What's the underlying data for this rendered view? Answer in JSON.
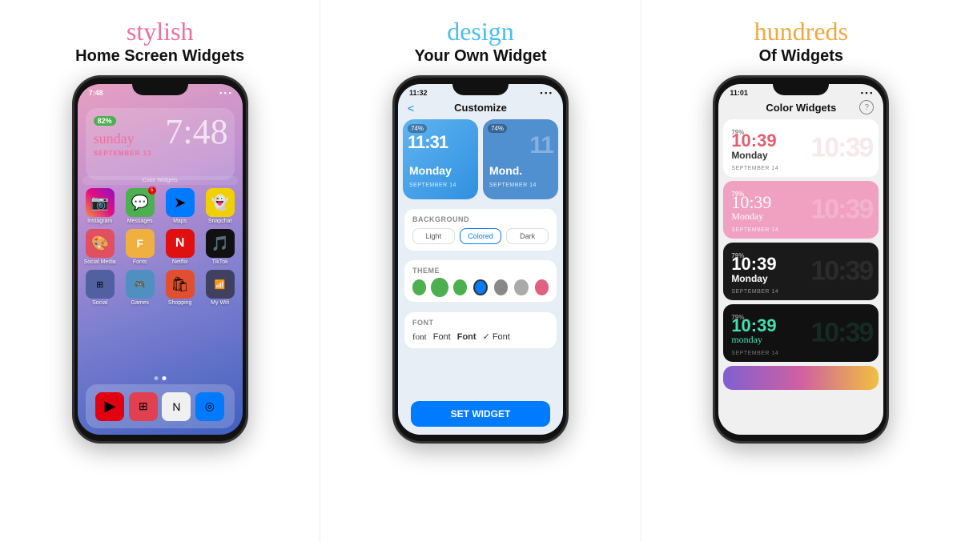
{
  "panel1": {
    "heading_cursive": "stylish",
    "heading_bold": "Home Screen Widgets",
    "status_time": "7:48",
    "battery": "82%",
    "time_display": "7:48",
    "day": "sunday",
    "date": "SEPTEMBER 13",
    "apps_row1": [
      {
        "icon": "📷",
        "label": "Instagram",
        "bg": "#c060a0"
      },
      {
        "icon": "💬",
        "label": "Messages",
        "bg": "#4caf50"
      },
      {
        "icon": "➤",
        "label": "Maps",
        "bg": "#007aff"
      },
      {
        "icon": "👻",
        "label": "Snapchat",
        "bg": "#f0d000"
      }
    ],
    "apps_row2": [
      {
        "icon": "🎨",
        "label": "Social Media",
        "bg": "#e05060"
      },
      {
        "icon": "F",
        "label": "Fonts",
        "bg": "#f0b040"
      },
      {
        "icon": "N",
        "label": "Netflix",
        "bg": "#e01010"
      },
      {
        "icon": "🎵",
        "label": "TikTok",
        "bg": "#111"
      }
    ],
    "apps_row3": [
      {
        "icon": "⊞",
        "label": "Social",
        "bg": "#6060a0"
      },
      {
        "icon": "🎮",
        "label": "Games",
        "bg": "#5090c0"
      },
      {
        "icon": "🛍",
        "label": "Shopping",
        "bg": "#e05030"
      },
      {
        "icon": "📝",
        "label": "My Wifi",
        "bg": "#505070"
      }
    ],
    "dock": [
      {
        "icon": "▶",
        "label": "YouTube",
        "bg": "#e00010"
      },
      {
        "icon": "⊞",
        "label": "App",
        "bg": "#e04050"
      },
      {
        "icon": "N",
        "label": "Notion",
        "bg": "#111"
      },
      {
        "icon": "◎",
        "label": "Safari",
        "bg": "#007aff"
      }
    ],
    "dots": [
      "inactive",
      "active"
    ]
  },
  "panel2": {
    "heading_cursive": "design",
    "heading_bold": "Your Own Widget",
    "status_time": "11:32",
    "screen_title": "Customize",
    "back_label": "<",
    "widget1": {
      "battery": "74%",
      "time": "11:31",
      "day": "Monday",
      "date": "SEPTEMBER 14"
    },
    "widget2": {
      "battery": "74%",
      "time": "11",
      "day": "Mond.",
      "date": "SEPTEMBER 14"
    },
    "background_label": "BACKGROUND",
    "bg_options": [
      "Light",
      "Colored",
      "Dark"
    ],
    "bg_selected": "Colored",
    "theme_label": "THEME",
    "theme_colors": [
      "#4caf50",
      "#4caf50",
      "#4caf50",
      "#007aff",
      "#888",
      "#888",
      "#e06080"
    ],
    "theme_selected": 3,
    "font_label": "FONT",
    "font_options": [
      "font",
      "Font",
      "Font",
      "✓ Font"
    ],
    "set_widget_label": "SET WIDGET"
  },
  "panel3": {
    "heading_cursive": "hundreds",
    "heading_bold": "Of Widgets",
    "status_time": "11:01",
    "screen_title": "Color Widgets",
    "help_label": "?",
    "widgets": [
      {
        "style": "white",
        "battery": "79%",
        "time_main": "10:39",
        "time_bg": "10:39",
        "day": "Monday",
        "date": "SEPTEMBER 14",
        "time_color": "#e06070",
        "day_color": "#333",
        "date_color": "#888"
      },
      {
        "style": "pink",
        "battery": "79%",
        "time_main": "10:39",
        "time_bg": "10:39",
        "day": "Monday",
        "date": "SEPTEMBER 14",
        "time_color": "#fff",
        "day_color": "#fff",
        "date_color": "rgba(255,255,255,0.8)"
      },
      {
        "style": "dark",
        "battery": "79%",
        "time_main": "10:39",
        "time_bg": "10:39",
        "day": "Monday",
        "date": "SEPTEMBER 14",
        "time_color": "#fff",
        "day_color": "#fff",
        "date_color": "rgba(255,255,255,0.6)"
      },
      {
        "style": "black",
        "battery": "79%",
        "time_main": "10:39",
        "time_bg": "10:39",
        "day": "monday",
        "date": "SEPTEMBER 14",
        "time_color": "#40e0b0",
        "day_color": "#40e0b0",
        "date_color": "rgba(255,255,255,0.5)"
      }
    ]
  }
}
